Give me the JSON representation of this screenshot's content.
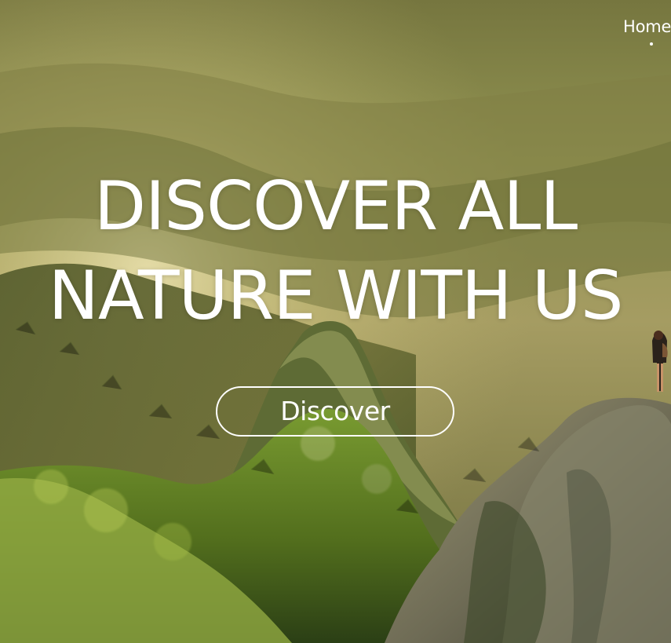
{
  "nav": {
    "items": [
      {
        "label": "Home"
      }
    ],
    "active_index": 0
  },
  "hero": {
    "headline_line1": "DISCOVER ALL",
    "headline_line2": "NATURE WITH US",
    "cta_label": "Discover",
    "background": "mountain-forest-photo",
    "colors": {
      "text": "#ffffff",
      "forest": "#4d5d22",
      "sun_haze": "#d8c98a"
    }
  }
}
